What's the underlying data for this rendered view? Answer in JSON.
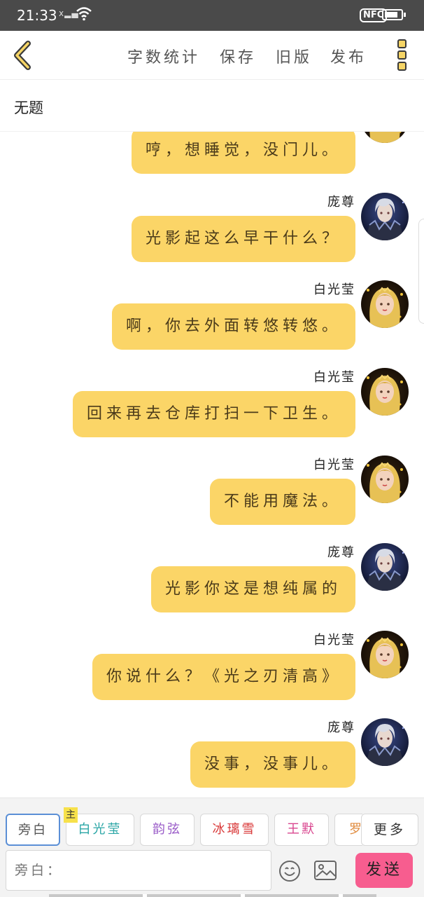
{
  "status_bar": {
    "time": "21:33",
    "nfc_label": "NFC"
  },
  "toolbar": {
    "back_icon": "chevron-left-icon",
    "items": [
      "字数统计",
      "保存",
      "旧版",
      "发布"
    ],
    "more_icon": "three-square-dots-icon"
  },
  "document": {
    "title": "无题"
  },
  "chat": {
    "messages": [
      {
        "speaker": "",
        "avatar": "blonde",
        "text": "哼，想睡觉，没门儿。"
      },
      {
        "speaker": "庞尊",
        "avatar": "silver",
        "text": "光影起这么早干什么？"
      },
      {
        "speaker": "白光莹",
        "avatar": "blonde",
        "text": "啊，你去外面转悠转悠。"
      },
      {
        "speaker": "白光莹",
        "avatar": "blonde",
        "text": "回来再去仓库打扫一下卫生。"
      },
      {
        "speaker": "白光莹",
        "avatar": "blonde",
        "text": "不能用魔法。"
      },
      {
        "speaker": "庞尊",
        "avatar": "silver",
        "text": "光影你这是想纯属的"
      },
      {
        "speaker": "白光莹",
        "avatar": "blonde",
        "text": "你说什么？《光之刃清高》"
      },
      {
        "speaker": "庞尊",
        "avatar": "silver",
        "text": "没事，没事儿。"
      }
    ]
  },
  "characters": {
    "chips": [
      {
        "label": "旁白",
        "color": "#555555",
        "active": true
      },
      {
        "label": "白光莹",
        "color": "#2aa6a6",
        "tag": "主"
      },
      {
        "label": "韵弦",
        "color": "#9a5cc8"
      },
      {
        "label": "冰璃雪",
        "color": "#d93a3a"
      },
      {
        "label": "王默",
        "color": "#d9468f"
      },
      {
        "label": "罗",
        "color": "#e08a3c"
      }
    ],
    "more_label": "更多"
  },
  "composer": {
    "placeholder": "旁白：",
    "emoji_icon": "smiley-icon",
    "image_icon": "image-icon",
    "send_label": "发送"
  }
}
